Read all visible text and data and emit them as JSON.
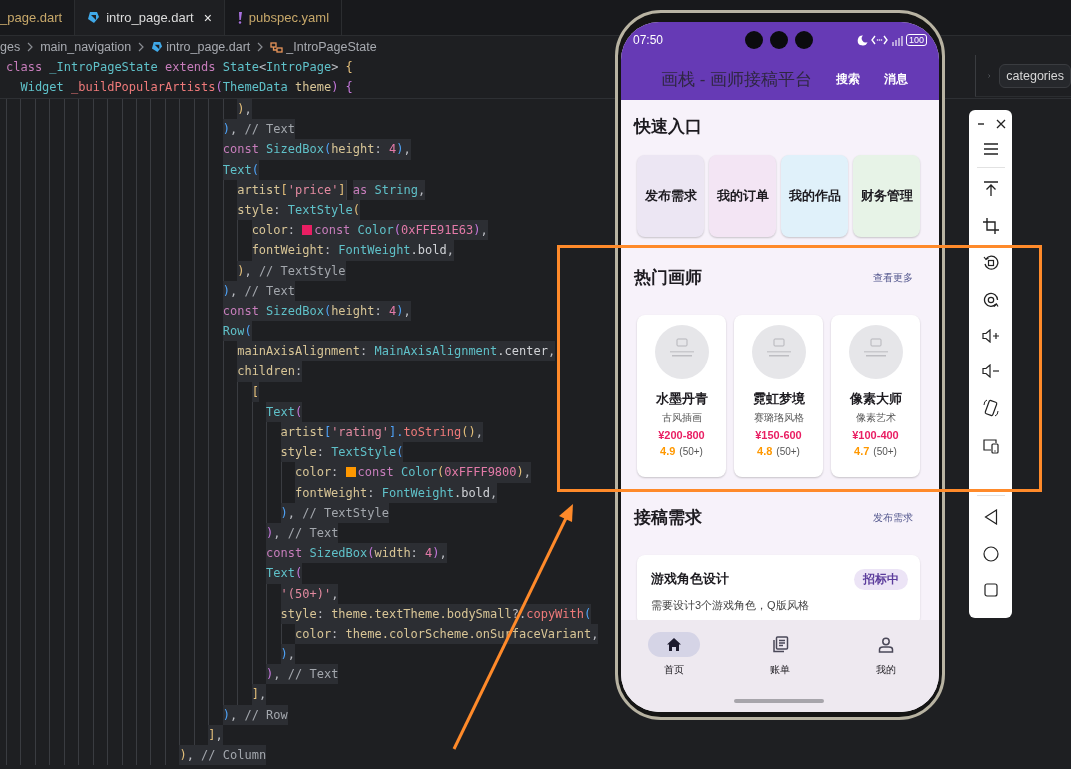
{
  "editor": {
    "tabs": [
      {
        "label": "_page.dart",
        "kind": "plain",
        "selected": false
      },
      {
        "label": "intro_page.dart",
        "kind": "dart",
        "selected": true,
        "close": "×"
      },
      {
        "label": "pubspec.yaml",
        "kind": "yaml",
        "selected": false
      }
    ],
    "breadcrumb": [
      {
        "label": "ges",
        "kind": "folder"
      },
      {
        "label": "main_navigation",
        "kind": "folder"
      },
      {
        "label": "intro_page.dart",
        "kind": "dart"
      },
      {
        "label": "_IntroPageState",
        "kind": "class"
      }
    ],
    "sticky_lines": [
      {
        "tokens": [
          {
            "text": "class ",
            "kind": "kw"
          },
          {
            "text": "_IntroPageState ",
            "kind": "type"
          },
          {
            "text": "extends ",
            "kind": "kw"
          },
          {
            "text": "State",
            "kind": "type"
          },
          {
            "text": "<",
            "kind": "p"
          },
          {
            "text": "IntroPage",
            "kind": "type"
          },
          {
            "text": "> ",
            "kind": "p"
          },
          {
            "text": "{",
            "kind": "by"
          }
        ]
      },
      {
        "tokens": [
          {
            "text": "  Widget ",
            "kind": "type"
          },
          {
            "text": "_buildPopularArtists",
            "kind": "fn"
          },
          {
            "text": "(",
            "kind": "bp"
          },
          {
            "text": "ThemeData ",
            "kind": "type"
          },
          {
            "text": "theme",
            "kind": "prop"
          },
          {
            "text": ") ",
            "kind": "bp"
          },
          {
            "text": "{",
            "kind": "bp"
          }
        ]
      }
    ],
    "lines": [
      {
        "tokens": [
          {
            "text": "                                )",
            "kind": "by"
          },
          {
            "text": ",",
            "kind": "p"
          }
        ]
      },
      {
        "tokens": [
          {
            "text": "                              )",
            "kind": "bb"
          },
          {
            "text": ", ",
            "kind": "p"
          },
          {
            "text": "// Text",
            "kind": "cmt"
          }
        ]
      },
      {
        "tokens": [
          {
            "text": "                              const ",
            "kind": "kw"
          },
          {
            "text": "SizedBox",
            "kind": "type"
          },
          {
            "text": "(",
            "kind": "bb"
          },
          {
            "text": "height",
            "kind": "prop"
          },
          {
            "text": ": ",
            "kind": "p"
          },
          {
            "text": "4",
            "kind": "num"
          },
          {
            "text": ")",
            "kind": "bb"
          },
          {
            "text": ",",
            "kind": "p"
          }
        ]
      },
      {
        "tokens": [
          {
            "text": "                              Text",
            "kind": "type"
          },
          {
            "text": "(",
            "kind": "bb"
          }
        ]
      },
      {
        "tokens": [
          {
            "text": "                                artist",
            "kind": "prop"
          },
          {
            "text": "[",
            "kind": "by"
          },
          {
            "text": "'price'",
            "kind": "str"
          },
          {
            "text": "]",
            "kind": "by"
          },
          {
            "text": " as ",
            "kind": "kw"
          },
          {
            "text": "String",
            "kind": "type"
          },
          {
            "text": ",",
            "kind": "p"
          }
        ]
      },
      {
        "tokens": [
          {
            "text": "                                style",
            "kind": "prop"
          },
          {
            "text": ": ",
            "kind": "p"
          },
          {
            "text": "TextStyle",
            "kind": "type"
          },
          {
            "text": "(",
            "kind": "by"
          }
        ]
      },
      {
        "tokens": [
          {
            "text": "                                  color",
            "kind": "prop"
          },
          {
            "text": ": ",
            "kind": "p"
          },
          {
            "kind": "swatch",
            "color": "#e91e63"
          },
          {
            "text": "const ",
            "kind": "kw"
          },
          {
            "text": "Color",
            "kind": "type"
          },
          {
            "text": "(",
            "kind": "bp"
          },
          {
            "text": "0xFFE91E63",
            "kind": "num"
          },
          {
            "text": ")",
            "kind": "bp"
          },
          {
            "text": ",",
            "kind": "p"
          }
        ]
      },
      {
        "tokens": [
          {
            "text": "                                  fontWeight",
            "kind": "prop"
          },
          {
            "text": ": ",
            "kind": "p"
          },
          {
            "text": "FontWeight",
            "kind": "type"
          },
          {
            "text": ".bold",
            "kind": "plain"
          },
          {
            "text": ",",
            "kind": "p"
          }
        ]
      },
      {
        "tokens": [
          {
            "text": "                                )",
            "kind": "by"
          },
          {
            "text": ", ",
            "kind": "p"
          },
          {
            "text": "// TextStyle",
            "kind": "cmt"
          }
        ]
      },
      {
        "tokens": [
          {
            "text": "                              )",
            "kind": "bb"
          },
          {
            "text": ", ",
            "kind": "p"
          },
          {
            "text": "// Text",
            "kind": "cmt"
          }
        ]
      },
      {
        "tokens": [
          {
            "text": "                              const ",
            "kind": "kw"
          },
          {
            "text": "SizedBox",
            "kind": "type"
          },
          {
            "text": "(",
            "kind": "bb"
          },
          {
            "text": "height",
            "kind": "prop"
          },
          {
            "text": ": ",
            "kind": "p"
          },
          {
            "text": "4",
            "kind": "num"
          },
          {
            "text": ")",
            "kind": "bb"
          },
          {
            "text": ",",
            "kind": "p"
          }
        ]
      },
      {
        "tokens": [
          {
            "text": "                              Row",
            "kind": "type"
          },
          {
            "text": "(",
            "kind": "bb"
          }
        ]
      },
      {
        "tokens": [
          {
            "text": "                                mainAxisAlignment",
            "kind": "prop"
          },
          {
            "text": ": ",
            "kind": "p"
          },
          {
            "text": "MainAxisAlignment",
            "kind": "type"
          },
          {
            "text": ".center",
            "kind": "plain"
          },
          {
            "text": ",",
            "kind": "p"
          }
        ]
      },
      {
        "tokens": [
          {
            "text": "                                children",
            "kind": "prop"
          },
          {
            "text": ":",
            "kind": "p"
          }
        ]
      },
      {
        "tokens": [
          {
            "text": "                                  [",
            "kind": "by"
          }
        ]
      },
      {
        "tokens": [
          {
            "text": "                                    Text",
            "kind": "type"
          },
          {
            "text": "(",
            "kind": "bp"
          }
        ]
      },
      {
        "tokens": [
          {
            "text": "                                      artist",
            "kind": "prop"
          },
          {
            "text": "[",
            "kind": "bb"
          },
          {
            "text": "'rating'",
            "kind": "str"
          },
          {
            "text": "].",
            "kind": "bb"
          },
          {
            "text": "toString",
            "kind": "fn"
          },
          {
            "text": "()",
            "kind": "by"
          },
          {
            "text": ",",
            "kind": "p"
          }
        ]
      },
      {
        "tokens": [
          {
            "text": "                                      style",
            "kind": "prop"
          },
          {
            "text": ": ",
            "kind": "p"
          },
          {
            "text": "TextStyle",
            "kind": "type"
          },
          {
            "text": "(",
            "kind": "bb"
          }
        ]
      },
      {
        "tokens": [
          {
            "text": "                                        color",
            "kind": "prop"
          },
          {
            "text": ": ",
            "kind": "p"
          },
          {
            "kind": "swatch",
            "color": "#ff9800"
          },
          {
            "text": "const ",
            "kind": "kw"
          },
          {
            "text": "Color",
            "kind": "type"
          },
          {
            "text": "(",
            "kind": "by"
          },
          {
            "text": "0xFFFF9800",
            "kind": "num"
          },
          {
            "text": ")",
            "kind": "by"
          },
          {
            "text": ",",
            "kind": "p"
          }
        ]
      },
      {
        "tokens": [
          {
            "text": "                                        fontWeight",
            "kind": "prop"
          },
          {
            "text": ": ",
            "kind": "p"
          },
          {
            "text": "FontWeight",
            "kind": "type"
          },
          {
            "text": ".bold",
            "kind": "plain"
          },
          {
            "text": ",",
            "kind": "p"
          }
        ]
      },
      {
        "tokens": [
          {
            "text": "                                      )",
            "kind": "bb"
          },
          {
            "text": ", ",
            "kind": "p"
          },
          {
            "text": "// TextStyle",
            "kind": "cmt"
          }
        ]
      },
      {
        "tokens": [
          {
            "text": "                                    )",
            "kind": "bp"
          },
          {
            "text": ", ",
            "kind": "p"
          },
          {
            "text": "// Text",
            "kind": "cmt"
          }
        ]
      },
      {
        "tokens": [
          {
            "text": "                                    const ",
            "kind": "kw"
          },
          {
            "text": "SizedBox",
            "kind": "type"
          },
          {
            "text": "(",
            "kind": "bp"
          },
          {
            "text": "width",
            "kind": "prop"
          },
          {
            "text": ": ",
            "kind": "p"
          },
          {
            "text": "4",
            "kind": "num"
          },
          {
            "text": ")",
            "kind": "bp"
          },
          {
            "text": ",",
            "kind": "p"
          }
        ]
      },
      {
        "tokens": [
          {
            "text": "                                    Text",
            "kind": "type"
          },
          {
            "text": "(",
            "kind": "bp"
          }
        ]
      },
      {
        "tokens": [
          {
            "text": "                                      '(50+)'",
            "kind": "str"
          },
          {
            "text": ",",
            "kind": "p"
          }
        ]
      },
      {
        "tokens": [
          {
            "text": "                                      style",
            "kind": "prop"
          },
          {
            "text": ": ",
            "kind": "p"
          },
          {
            "text": "theme.textTheme.bodySmall",
            "kind": "prop"
          },
          {
            "text": "?.",
            "kind": "p"
          },
          {
            "text": "copyWith",
            "kind": "fn"
          },
          {
            "text": "(",
            "kind": "bb"
          }
        ]
      },
      {
        "tokens": [
          {
            "text": "                                        color",
            "kind": "prop"
          },
          {
            "text": ": ",
            "kind": "p"
          },
          {
            "text": "theme.colorScheme.onSurfaceVariant",
            "kind": "prop"
          },
          {
            "text": ",",
            "kind": "p"
          }
        ]
      },
      {
        "tokens": [
          {
            "text": "                                      )",
            "kind": "bb"
          },
          {
            "text": ",",
            "kind": "p"
          }
        ]
      },
      {
        "tokens": [
          {
            "text": "                                    )",
            "kind": "bp"
          },
          {
            "text": ", ",
            "kind": "p"
          },
          {
            "text": "// Text",
            "kind": "cmt"
          }
        ]
      },
      {
        "tokens": [
          {
            "text": "                                  ]",
            "kind": "by"
          },
          {
            "text": ",",
            "kind": "p"
          }
        ]
      },
      {
        "tokens": [
          {
            "text": "                              )",
            "kind": "bb"
          },
          {
            "text": ", ",
            "kind": "p"
          },
          {
            "text": "// Row",
            "kind": "cmt"
          }
        ]
      },
      {
        "tokens": [
          {
            "text": "                            ]",
            "kind": "by"
          },
          {
            "text": ",",
            "kind": "p"
          }
        ]
      },
      {
        "tokens": [
          {
            "text": "                        )",
            "kind": "by"
          },
          {
            "text": ", ",
            "kind": "p"
          },
          {
            "text": "// Column",
            "kind": "cmt"
          }
        ]
      }
    ]
  },
  "side_breadcrumb": {
    "label": "categories"
  },
  "phone": {
    "status_bar": {
      "time": "07:50",
      "battery": "100"
    },
    "app_bar": {
      "title": "画栈 - 画师接稿平台",
      "actions": [
        "搜索",
        "消息"
      ]
    },
    "quick_entry": {
      "title": "快速入口",
      "items": [
        {
          "label": "发布需求",
          "color": "#ece6f3"
        },
        {
          "label": "我的订单",
          "color": "#f3e5f4"
        },
        {
          "label": "我的作品",
          "color": "#e0f1fa"
        },
        {
          "label": "财务管理",
          "color": "#e7f3e7"
        }
      ]
    },
    "popular_artists": {
      "title": "热门画师",
      "more": "查看更多",
      "artists": [
        {
          "name": "水墨丹青",
          "style": "古风插画",
          "price": "¥200-800",
          "rating": "4.9",
          "reviews": "(50+)"
        },
        {
          "name": "霓虹梦境",
          "style": "赛璐珞风格",
          "price": "¥150-600",
          "rating": "4.8",
          "reviews": "(50+)"
        },
        {
          "name": "像素大师",
          "style": "像素艺术",
          "price": "¥100-400",
          "rating": "4.7",
          "reviews": "(50+)"
        }
      ]
    },
    "requests": {
      "title": "接稿需求",
      "action": "发布需求",
      "items": [
        {
          "title": "游戏角色设计",
          "status": "招标中",
          "description": "需要设计3个游戏角色，Q版风格"
        }
      ]
    },
    "bottom_nav": [
      {
        "label": "首页",
        "selected": true
      },
      {
        "label": "账单",
        "selected": false
      },
      {
        "label": "我的",
        "selected": false
      }
    ]
  }
}
